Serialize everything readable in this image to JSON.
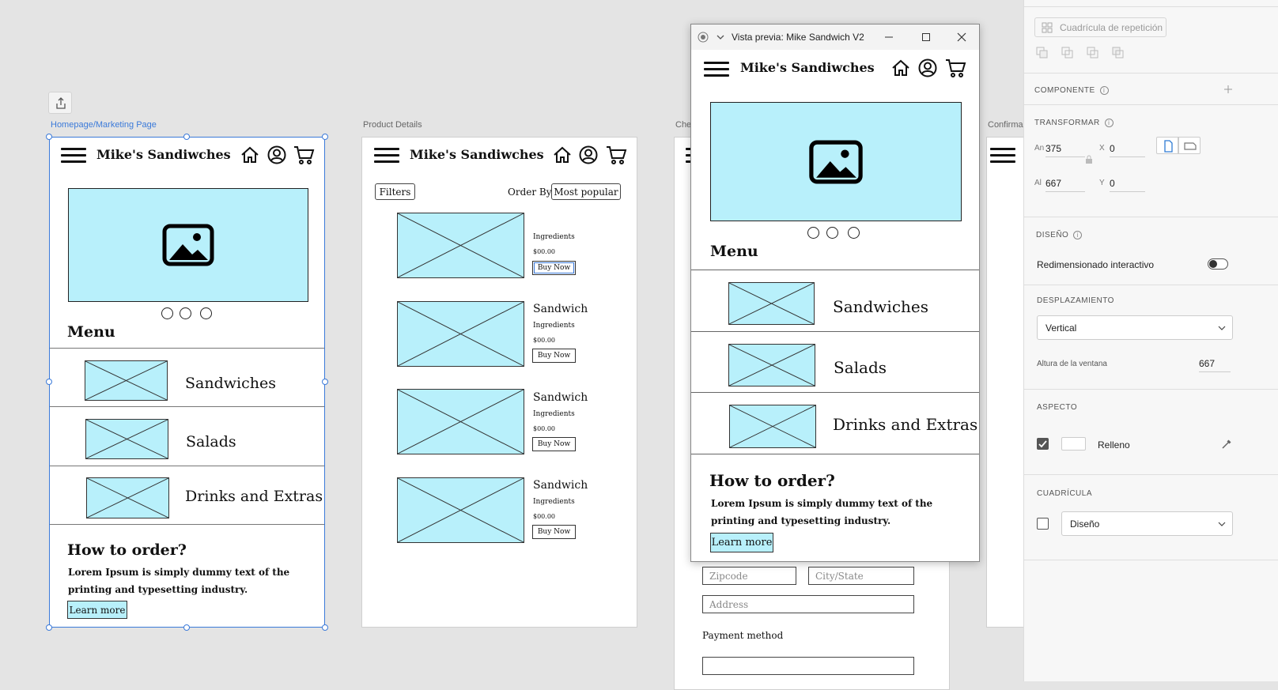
{
  "canvas": {
    "artboards": [
      {
        "label": "Homepage/Marketing Page"
      },
      {
        "label": "Product Details"
      },
      {
        "label": "Che"
      },
      {
        "label": "Confirma"
      }
    ]
  },
  "homepage": {
    "brand": "Mike's Sandiwches",
    "menu_heading": "Menu",
    "categories": [
      "Sandwiches",
      "Salads",
      "Drinks and Extras"
    ],
    "how_heading": "How to order?",
    "lorem": "Lorem Ipsum is simply dummy text of the printing and typesetting industry.",
    "learn_more": "Learn more"
  },
  "product": {
    "brand": "Mike's Sandiwches",
    "filters": "Filters",
    "order_by": "Order By:",
    "order_value": "Most popular",
    "items": [
      {
        "title": "",
        "ingredients": "Ingredients",
        "price": "$00.00",
        "buy": "Buy Now"
      },
      {
        "title": "Sandwich",
        "ingredients": "Ingredients",
        "price": "$00.00",
        "buy": "Buy Now"
      },
      {
        "title": "Sandwich",
        "ingredients": "Ingredients",
        "price": "$00.00",
        "buy": "Buy Now"
      },
      {
        "title": "Sandwich",
        "ingredients": "Ingredients",
        "price": "$00.00",
        "buy": "Buy Now"
      }
    ]
  },
  "checkout": {
    "zipcode": "Zipcode",
    "citystate": "City/State",
    "address": "Address",
    "payment": "Payment method"
  },
  "preview": {
    "title": "Vista previa: Mike Sandwich V2",
    "brand": "Mike's Sandiwches",
    "menu_heading": "Menu",
    "categories": [
      "Sandwiches",
      "Salads",
      "Drinks and Extras"
    ],
    "how_heading": "How to order?",
    "lorem": "Lorem Ipsum is simply dummy text of the printing and typesetting industry.",
    "learn_more": "Learn more"
  },
  "panel": {
    "repeat_grid": "Cuadrícula de repetición",
    "component": "COMPONENTE",
    "transform": "TRANSFORMAR",
    "w_label": "An",
    "w": "375",
    "h_label": "Al",
    "h": "667",
    "x_label": "X",
    "x": "0",
    "y_label": "Y",
    "y": "0",
    "layout": "DISEÑO",
    "responsive_resize": "Redimensionado interactivo",
    "scrolling": "DESPLAZAMIENTO",
    "scroll_value": "Vertical",
    "viewport_height_label": "Altura de la ventana",
    "viewport_height": "667",
    "appearance": "ASPECTO",
    "fill": "Relleno",
    "grid": "CUADRÍCULA",
    "grid_value": "Diseño"
  }
}
